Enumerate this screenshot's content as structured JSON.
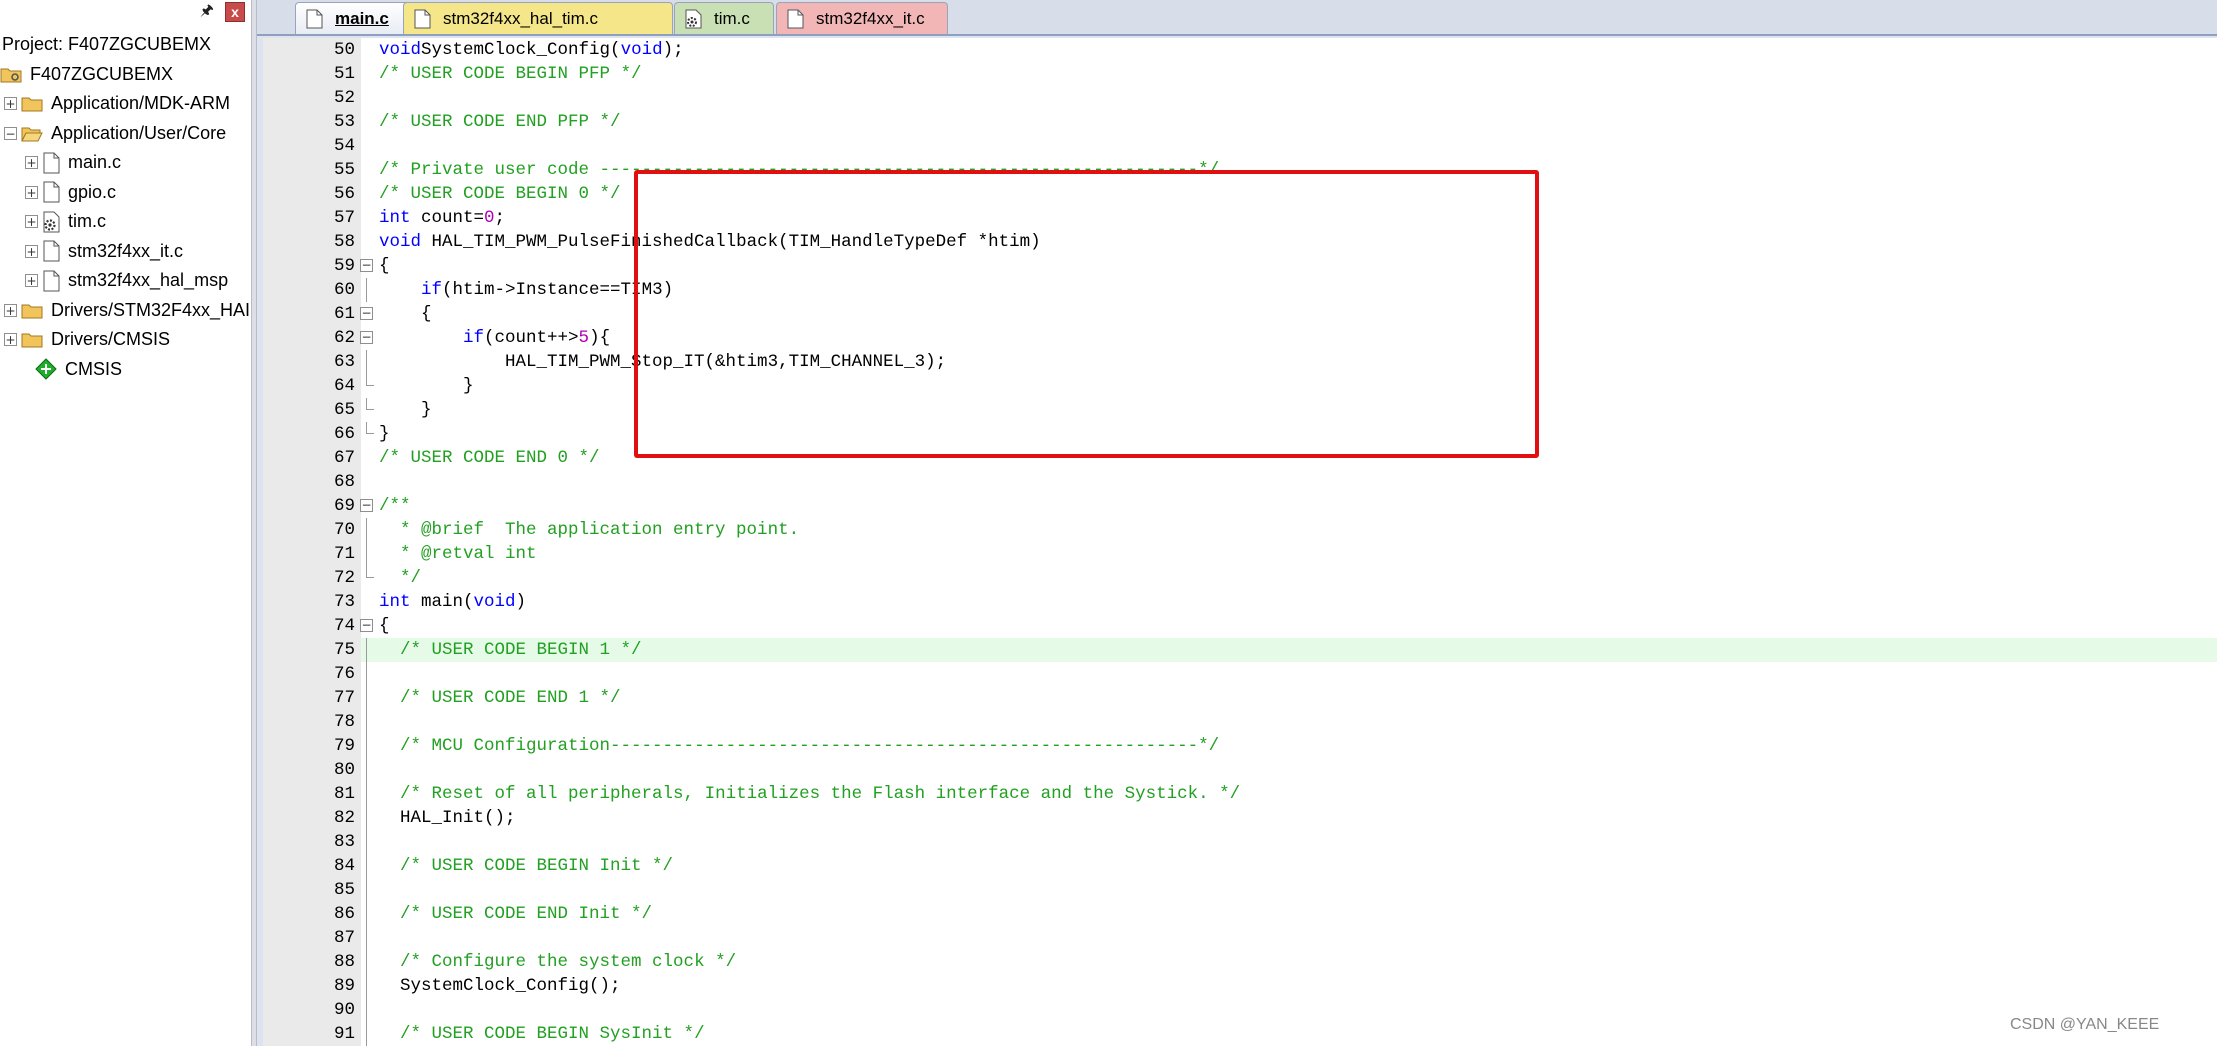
{
  "project_panel": {
    "pin_icon": "pin-icon",
    "close_label": "x",
    "title": "Project: F407ZGCUBEMX",
    "tree": [
      {
        "label": "F407ZGCUBEMX",
        "icon": "project-folder-icon",
        "indent": 0,
        "expander": ""
      },
      {
        "label": "Application/MDK-ARM",
        "icon": "folder-icon",
        "indent": 1,
        "expander": "+"
      },
      {
        "label": "Application/User/Core",
        "icon": "folder-open-icon",
        "indent": 1,
        "expander": "−"
      },
      {
        "label": "main.c",
        "icon": "file-icon",
        "indent": 2,
        "expander": "+"
      },
      {
        "label": "gpio.c",
        "icon": "file-icon",
        "indent": 2,
        "expander": "+"
      },
      {
        "label": "tim.c",
        "icon": "file-gear-icon",
        "indent": 2,
        "expander": "+"
      },
      {
        "label": "stm32f4xx_it.c",
        "icon": "file-icon",
        "indent": 2,
        "expander": "+"
      },
      {
        "label": "stm32f4xx_hal_msp",
        "icon": "file-icon",
        "indent": 2,
        "expander": "+"
      },
      {
        "label": "Drivers/STM32F4xx_HAI",
        "icon": "folder-icon",
        "indent": 1,
        "expander": "+"
      },
      {
        "label": "Drivers/CMSIS",
        "icon": "folder-icon",
        "indent": 1,
        "expander": "+"
      },
      {
        "label": "CMSIS",
        "icon": "cmsis-diamond-icon",
        "indent": 1,
        "expander": ""
      }
    ]
  },
  "tabs": [
    {
      "label": "main.c",
      "active": true
    },
    {
      "label": "stm32f4xx_hal_tim.c",
      "active": false
    },
    {
      "label": "tim.c",
      "active": false
    },
    {
      "label": "stm32f4xx_it.c",
      "active": false
    }
  ],
  "colors": {
    "keyword": "#0000ff",
    "comment": "#22a022",
    "number": "#b000b0",
    "highlight_box": "#e01010",
    "current_line": "#e6fae8"
  },
  "code_lines": [
    {
      "n": "50",
      "fold": "",
      "segs": [
        [
          "kw",
          "void"
        ],
        [
          "",
          "SystemClock_Config("
        ],
        [
          "kw",
          "void"
        ],
        [
          "",
          ");"
        ]
      ]
    },
    {
      "n": "51",
      "fold": "",
      "segs": [
        [
          "cm",
          "/* USER CODE BEGIN PFP */"
        ]
      ]
    },
    {
      "n": "52",
      "fold": "",
      "segs": []
    },
    {
      "n": "53",
      "fold": "",
      "segs": [
        [
          "cm",
          "/* USER CODE END PFP */"
        ]
      ]
    },
    {
      "n": "54",
      "fold": "",
      "segs": []
    },
    {
      "n": "55",
      "fold": "",
      "segs": [
        [
          "cm",
          "/* Private user code ---------------------------------------------------------*/"
        ]
      ]
    },
    {
      "n": "56",
      "fold": "",
      "segs": [
        [
          "cm",
          "/* USER CODE BEGIN 0 */"
        ]
      ]
    },
    {
      "n": "57",
      "fold": "",
      "segs": [
        [
          "kw",
          "int"
        ],
        [
          "",
          " count="
        ],
        [
          "num",
          "0"
        ],
        [
          "",
          ";"
        ]
      ]
    },
    {
      "n": "58",
      "fold": "",
      "segs": [
        [
          "kw",
          "void"
        ],
        [
          "",
          " HAL_TIM_PWM_PulseFinishedCallback(TIM_HandleTypeDef *htim)"
        ]
      ]
    },
    {
      "n": "59",
      "fold": "box",
      "segs": [
        [
          "",
          "{"
        ]
      ]
    },
    {
      "n": "60",
      "fold": "tick",
      "segs": [
        [
          "",
          "    "
        ],
        [
          "kw",
          "if"
        ],
        [
          "",
          "(htim->Instance==TIM3)"
        ]
      ]
    },
    {
      "n": "61",
      "fold": "box",
      "segs": [
        [
          "",
          "    {"
        ]
      ]
    },
    {
      "n": "62",
      "fold": "box",
      "segs": [
        [
          "",
          "        "
        ],
        [
          "kw",
          "if"
        ],
        [
          "",
          "(count++>"
        ],
        [
          "num",
          "5"
        ],
        [
          "",
          "){"
        ]
      ]
    },
    {
      "n": "63",
      "fold": "tick",
      "segs": [
        [
          "",
          "            HAL_TIM_PWM_Stop_IT(&htim3,TIM_CHANNEL_3);"
        ]
      ]
    },
    {
      "n": "64",
      "fold": "end",
      "segs": [
        [
          "",
          "        }"
        ]
      ]
    },
    {
      "n": "65",
      "fold": "end",
      "segs": [
        [
          "",
          "    }"
        ]
      ]
    },
    {
      "n": "66",
      "fold": "end",
      "segs": [
        [
          "",
          "}"
        ]
      ]
    },
    {
      "n": "67",
      "fold": "",
      "segs": [
        [
          "cm",
          "/* USER CODE END 0 */"
        ]
      ]
    },
    {
      "n": "68",
      "fold": "",
      "segs": []
    },
    {
      "n": "69",
      "fold": "box",
      "segs": [
        [
          "cm",
          "/**"
        ]
      ]
    },
    {
      "n": "70",
      "fold": "tick",
      "segs": [
        [
          "cm",
          "  * @brief  The application entry point."
        ]
      ]
    },
    {
      "n": "71",
      "fold": "tick",
      "segs": [
        [
          "cm",
          "  * @retval int"
        ]
      ]
    },
    {
      "n": "72",
      "fold": "end",
      "segs": [
        [
          "cm",
          "  */"
        ]
      ]
    },
    {
      "n": "73",
      "fold": "",
      "segs": [
        [
          "kw",
          "int"
        ],
        [
          "",
          " main("
        ],
        [
          "kw",
          "void"
        ],
        [
          "",
          ")"
        ]
      ]
    },
    {
      "n": "74",
      "fold": "box",
      "segs": [
        [
          "",
          "{"
        ]
      ]
    },
    {
      "n": "75",
      "fold": "tick",
      "current": true,
      "segs": [
        [
          "",
          "  "
        ],
        [
          "cm",
          "/* USER CODE BEGIN 1 */"
        ]
      ]
    },
    {
      "n": "76",
      "fold": "tick",
      "segs": []
    },
    {
      "n": "77",
      "fold": "tick",
      "segs": [
        [
          "",
          "  "
        ],
        [
          "cm",
          "/* USER CODE END 1 */"
        ]
      ]
    },
    {
      "n": "78",
      "fold": "tick",
      "segs": []
    },
    {
      "n": "79",
      "fold": "tick",
      "segs": [
        [
          "",
          "  "
        ],
        [
          "cm",
          "/* MCU Configuration--------------------------------------------------------*/"
        ]
      ]
    },
    {
      "n": "80",
      "fold": "tick",
      "segs": []
    },
    {
      "n": "81",
      "fold": "tick",
      "segs": [
        [
          "",
          "  "
        ],
        [
          "cm",
          "/* Reset of all peripherals, Initializes the Flash interface and the Systick. */"
        ]
      ]
    },
    {
      "n": "82",
      "fold": "tick",
      "segs": [
        [
          "",
          "  HAL_Init();"
        ]
      ]
    },
    {
      "n": "83",
      "fold": "tick",
      "segs": []
    },
    {
      "n": "84",
      "fold": "tick",
      "segs": [
        [
          "",
          "  "
        ],
        [
          "cm",
          "/* USER CODE BEGIN Init */"
        ]
      ]
    },
    {
      "n": "85",
      "fold": "tick",
      "segs": []
    },
    {
      "n": "86",
      "fold": "tick",
      "segs": [
        [
          "",
          "  "
        ],
        [
          "cm",
          "/* USER CODE END Init */"
        ]
      ]
    },
    {
      "n": "87",
      "fold": "tick",
      "segs": []
    },
    {
      "n": "88",
      "fold": "tick",
      "segs": [
        [
          "",
          "  "
        ],
        [
          "cm",
          "/* Configure the system clock */"
        ]
      ]
    },
    {
      "n": "89",
      "fold": "tick",
      "segs": [
        [
          "",
          "  SystemClock_Config();"
        ]
      ]
    },
    {
      "n": "90",
      "fold": "tick",
      "segs": []
    },
    {
      "n": "91",
      "fold": "tick",
      "segs": [
        [
          "",
          "  "
        ],
        [
          "cm",
          "/* USER CODE BEGIN SysInit */"
        ]
      ]
    }
  ],
  "watermark": "CSDN @YAN_KEEE"
}
